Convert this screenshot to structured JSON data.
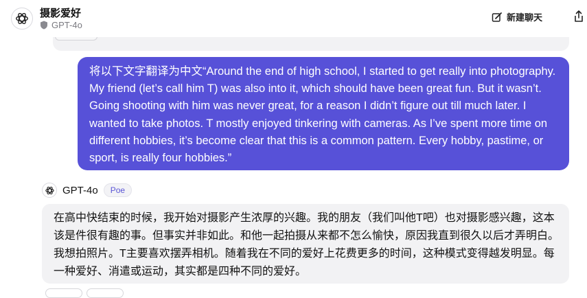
{
  "header": {
    "title": "摄影爱好",
    "model": "GPT-4o",
    "new_chat_label": "新建聊天",
    "bot_icon": "openai-logo-icon",
    "shield_icon": "shield-icon",
    "new_chat_icon": "new-chat-icon",
    "share_icon": "share-icon"
  },
  "messages": {
    "user_text": "将以下文字翻译为中文“Around the end of high school, I started to get really into photography. My friend (let’s call him T) was also into it, which should have been great fun. But it wasn’t. Going shooting with him was never great, for a reason I didn’t figure out till much later. I wanted to take photos. T mostly enjoyed tinkering with cameras. As I’ve spent more time on different hobbies, it’s become clear that this is a common pattern. Every hobby, pastime, or sport, is really four hobbies.”",
    "bot_name": "GPT-4o",
    "bot_badge": "Poe",
    "bot_text": "在高中快结束的时候，我开始对摄影产生浓厚的兴趣。我的朋友（我们叫他T吧）也对摄影感兴趣，这本该是件很有趣的事。但事实并非如此。和他一起拍摄从来都不怎么愉快，原因我直到很久以后才弄明白。我想拍照片。T主要喜欢摆弄相机。随着我在不同的爱好上花费更多的时间，这种模式变得越发明显。每一种爱好、消遣或运动，其实都是四种不同的爱好。"
  },
  "colors": {
    "user_bubble": "#5751d8",
    "bot_bubble": "#f2f2f4",
    "accent": "#5b56d6"
  }
}
